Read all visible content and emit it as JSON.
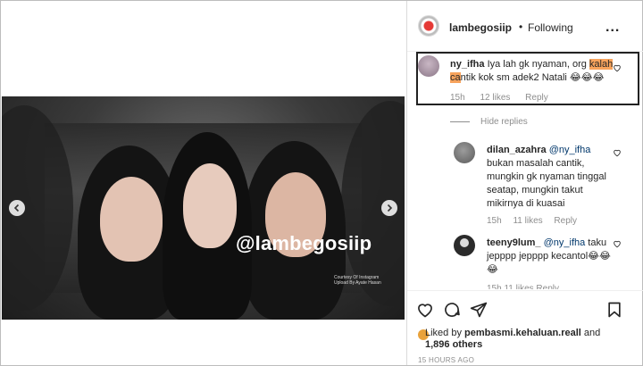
{
  "post": {
    "watermark": "@lambegosiip",
    "credit": "Courtesy Of Instagram\nUpload By Ayate Hasan"
  },
  "header": {
    "username": "lambegosiip",
    "separator": "•",
    "follow_status": "Following",
    "more": "..."
  },
  "comments": [
    {
      "username": "ny_ifha",
      "text_before": " Iya lah gk nyaman, org ",
      "highlight_1": "kalah",
      "space": " ",
      "highlight_2": "ca",
      "text_after": "ntik kok sm adek2 Natali 😂😂😂",
      "time": "15h",
      "likes": "12 likes",
      "reply": "Reply"
    }
  ],
  "hide_replies": "Hide replies",
  "replies": [
    {
      "username": "dilan_azahra",
      "mention": "@ny_ifha",
      "text": "bukan masalah cantik, mungkin gk nyaman tinggal seatap, mungkin takut mikirnya di kuasai",
      "time": "15h",
      "likes": "11 likes",
      "reply": "Reply"
    },
    {
      "username": "teeny9lum_",
      "mention": "@ny_ifha",
      "text": "taku jepppp jepppp kecantol😂😂😂"
    }
  ],
  "cutoff_meta": "15h   11 likes   Reply",
  "liked_by": {
    "prefix": "Liked by ",
    "user": "pembasmi.kehaluan.reall",
    "middle": " and",
    "count": "1,896 others"
  },
  "timestamp": "15 HOURS AGO",
  "colors": {
    "highlight": "#f7a35c",
    "muted": "#8e8e8e",
    "link": "#00376b"
  }
}
